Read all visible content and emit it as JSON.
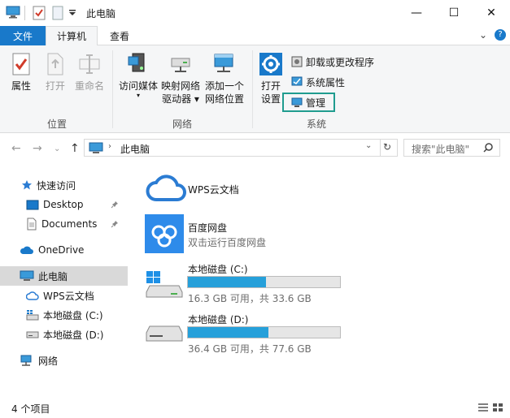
{
  "window": {
    "title": "此电脑",
    "controls": {
      "minimize": "—",
      "maximize": "☐",
      "close": "✕"
    }
  },
  "tabs": {
    "file": "文件",
    "computer": "计算机",
    "view": "查看",
    "expand": "⌄",
    "help": "?"
  },
  "ribbon": {
    "groups": [
      {
        "label": "位置"
      },
      {
        "label": "网络"
      },
      {
        "label": "系统"
      }
    ],
    "properties": "属性",
    "open": "打开",
    "rename": "重命名",
    "access_media": "访问媒体",
    "map_drive_line1": "映射网络",
    "map_drive_line2": "驱动器",
    "add_location_line1": "添加一个",
    "add_location_line2": "网络位置",
    "open_settings_line1": "打开",
    "open_settings_line2": "设置",
    "uninstall": "卸载或更改程序",
    "system_props": "系统属性",
    "manage": "管理"
  },
  "address": {
    "path": "此电脑",
    "search_placeholder": "搜索\"此电脑\""
  },
  "nav": {
    "quick_access": "快速访问",
    "desktop": "Desktop",
    "documents": "Documents",
    "onedrive": "OneDrive",
    "this_pc": "此电脑",
    "wps": "WPS云文档",
    "drive_c": "本地磁盘 (C:)",
    "drive_d": "本地磁盘 (D:)",
    "network": "网络"
  },
  "content": {
    "wps": {
      "name": "WPS云文档"
    },
    "baidu": {
      "name": "百度网盘",
      "sub": "双击运行百度网盘"
    },
    "drive_c": {
      "name": "本地磁盘 (C:)",
      "free_text": "16.3 GB 可用，共 33.6 GB",
      "used_fraction": 0.515
    },
    "drive_d": {
      "name": "本地磁盘 (D:)",
      "free_text": "36.4 GB 可用，共 77.6 GB",
      "used_fraction": 0.531
    }
  },
  "status": {
    "count": "4 个项目"
  },
  "colors": {
    "accent": "#1979ca",
    "highlight": "#1f9c8f",
    "bar": "#26a0da"
  }
}
